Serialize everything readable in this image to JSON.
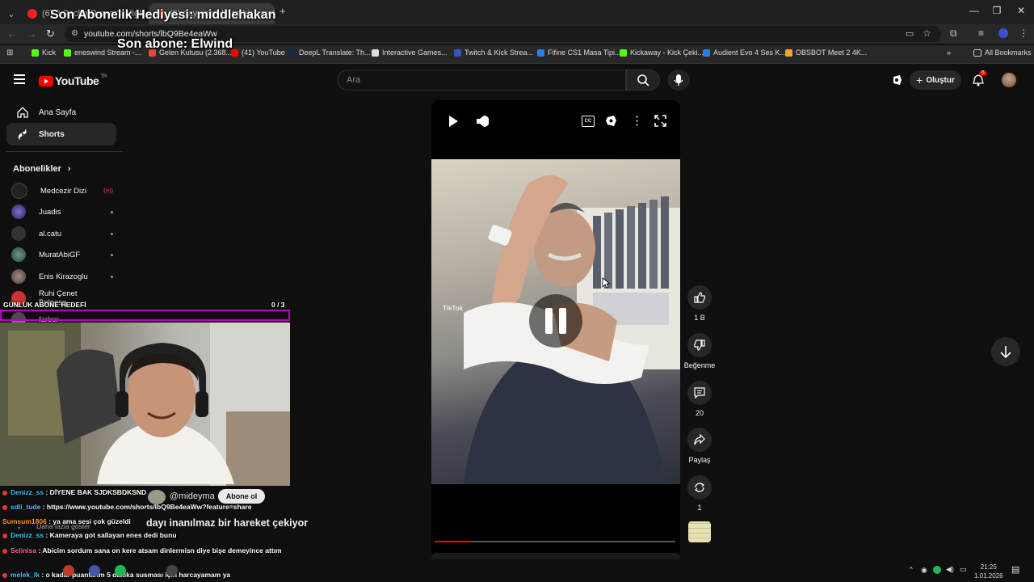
{
  "browser": {
    "tabs": [
      {
        "label": "(6) 3 Sacha Rumor's High Stre...",
        "active": false
      },
      {
        "label": "(6) dayı inanılmaz bir hareke...",
        "active": true
      }
    ],
    "new_tab": "+",
    "url": "youtube.com/shorts/lbQ9Be4eaWw",
    "bookmarks": [
      {
        "label": "Kick",
        "color": "#53fc18"
      },
      {
        "label": "eneswind Stream -...",
        "color": "#53fc18"
      },
      {
        "label": "Gelen Kutusu (2.368...",
        "color": "#ea4335"
      },
      {
        "label": "(41) YouTube",
        "color": "#ff0000"
      },
      {
        "label": "DeepL Translate: Th...",
        "color": "#0f2b46"
      },
      {
        "label": "Interactive Games...",
        "color": "#dddddd"
      },
      {
        "label": "Twitch & Kick Strea...",
        "color": "#3355cc"
      },
      {
        "label": "Fifine CS1 Masa Tipi...",
        "color": "#2a7de1"
      },
      {
        "label": "Kickaway - Kick Çeki...",
        "color": "#53fc18"
      },
      {
        "label": "Audient Evo 4 Ses K...",
        "color": "#2a7de1"
      },
      {
        "label": "OBSBOT Meet 2 4K...",
        "color": "#f5a623"
      }
    ],
    "all_bookmarks": "All Bookmarks"
  },
  "youtube": {
    "logo": "YouTube",
    "logo_sup": "TR",
    "search_placeholder": "Ara",
    "create_label": "Oluştur",
    "notif_count": "6"
  },
  "sidebar": {
    "nav": [
      {
        "label": "Ana Sayfa",
        "icon": "home-icon"
      },
      {
        "label": "Shorts",
        "icon": "shorts-icon",
        "active": true
      }
    ],
    "subs_header": "Abonelikler",
    "subs": [
      {
        "label": "Medcezir Dizi",
        "live": true,
        "color": "#222"
      },
      {
        "label": "Juadis",
        "color": "#5a4fa0"
      },
      {
        "label": "al.catu",
        "color": "#444"
      },
      {
        "label": "MuratAbiGF",
        "color": "#3d6b5a"
      },
      {
        "label": "Enis Kirazoglu",
        "color": "#6a5a55"
      },
      {
        "label": "Ruhi Çenet Belgese...",
        "color": "#c33"
      },
      {
        "label": "farber",
        "color": "#777"
      }
    ],
    "show_more": "Daha fazla göster"
  },
  "overlay": {
    "last_gift": "Son Abonelik Hediyesi: middlehakan",
    "last_sub": "Son abone: Elwind",
    "goal_label": "GÜNLÜK ABONE HEDEFİ",
    "goal_value": "0 / 3",
    "goal_progress": 0
  },
  "short": {
    "channel": "@mideyma",
    "subscribe": "Abone ol",
    "title": "dayı inanılmaz bir hareket çekiyor",
    "watermark": "TikTok",
    "likes": "1 B",
    "dislike_label": "Beğenme",
    "comments": "20",
    "share_label": "Paylaş",
    "remix": "1",
    "progress": 0.15
  },
  "chat": [
    {
      "user": "Denizz_ss",
      "color": "#3ec6ff",
      "msg": ": DİYENE BAK SJDKSBDKSND"
    },
    {
      "user": "sdli_tude",
      "color": "#3ec6ff",
      "msg": ": https://www.youtube.com/shorts/lbQ9Be4eaWw?feature=share"
    },
    {
      "user": "Sumsum1806",
      "color": "#ff9f1a",
      "msg": ": ya ama sesi çok güzeldi"
    },
    {
      "user": "Denizz_ss",
      "color": "#3ec6ff",
      "msg": ": Kameraya got sallayan enes dedi bunu"
    },
    {
      "user": "Selinisa",
      "color": "#ff5fa2",
      "msg": ": Abicim sordum sana on kere atsam dinlermisn diye bişe demeyince attım"
    },
    {
      "user": "melek_lk",
      "color": "#3ec6ff",
      "msg": ": o kadar puanlarım 5 dakika susması için harcayamam ya"
    }
  ],
  "tray": {
    "time": "21:25",
    "date": "1.01.2026"
  }
}
